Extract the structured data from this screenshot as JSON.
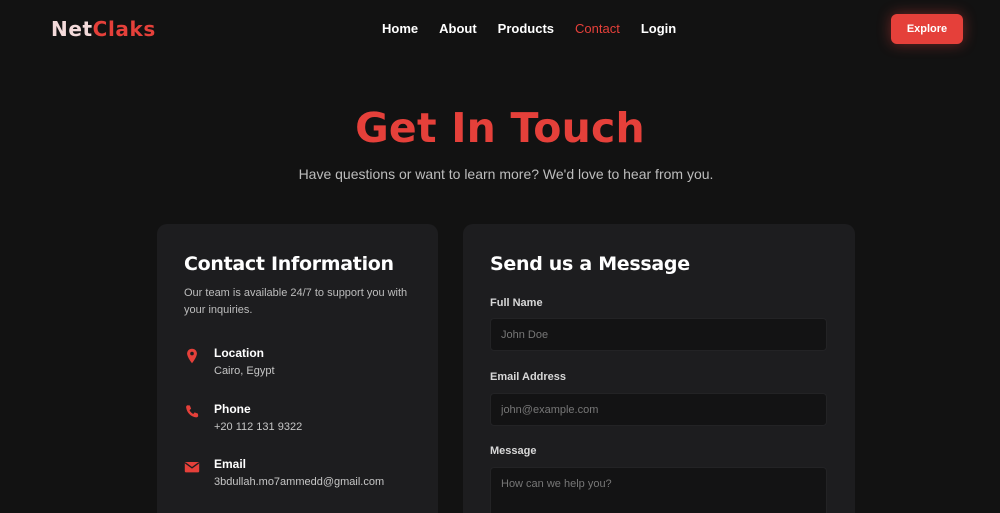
{
  "brand": {
    "part1": "Net",
    "part2": "Claks",
    "color_primary": "#e5403a"
  },
  "nav": {
    "links": [
      {
        "label": "Home"
      },
      {
        "label": "About"
      },
      {
        "label": "Products"
      },
      {
        "label": "Contact",
        "active": true
      },
      {
        "label": "Login"
      }
    ],
    "cta_label": "Explore"
  },
  "hero": {
    "title": "Get In Touch",
    "subtitle": "Have questions or want to learn more? We'd love to hear from you."
  },
  "contact_info": {
    "title": "Contact Information",
    "description": "Our team is available 24/7 to support you with your inquiries.",
    "items": [
      {
        "label": "Location",
        "value": "Cairo, Egypt",
        "icon": "location-pin-icon"
      },
      {
        "label": "Phone",
        "value": "+20 112 131 9322",
        "icon": "phone-icon"
      },
      {
        "label": "Email",
        "value": "3bdullah.mo7ammedd@gmail.com",
        "icon": "envelope-icon"
      }
    ]
  },
  "message_form": {
    "title": "Send us a Message",
    "fields": [
      {
        "label": "Full Name",
        "placeholder": "John Doe",
        "value": ""
      },
      {
        "label": "Email Address",
        "placeholder": "john@example.com",
        "value": ""
      },
      {
        "label": "Message",
        "placeholder": "How can we help you?",
        "value": ""
      }
    ]
  }
}
